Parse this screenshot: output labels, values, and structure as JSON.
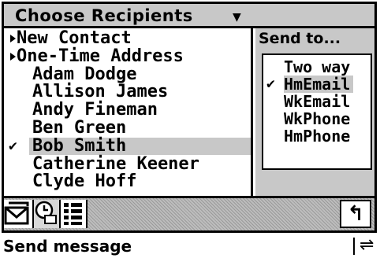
{
  "title": "Choose Recipients",
  "contacts": [
    {
      "label": "New Contact",
      "type": "action"
    },
    {
      "label": "One-Time Address",
      "type": "action"
    },
    {
      "label": "Adam Dodge",
      "type": "contact"
    },
    {
      "label": "Allison James",
      "type": "contact"
    },
    {
      "label": "Andy Fineman",
      "type": "contact"
    },
    {
      "label": "Ben Green",
      "type": "contact"
    },
    {
      "label": "Bob Smith",
      "type": "contact",
      "selected": true
    },
    {
      "label": "Catherine Keener",
      "type": "contact"
    },
    {
      "label": "Clyde Hoff",
      "type": "contact"
    }
  ],
  "send_to": {
    "label": "Send to...",
    "options": [
      {
        "label": "Two way",
        "checked": false
      },
      {
        "label": "HmEmail",
        "checked": true
      },
      {
        "label": "WkEmail",
        "checked": false
      },
      {
        "label": "WkPhone",
        "checked": false
      },
      {
        "label": "HmPhone",
        "checked": false
      }
    ]
  },
  "toolbar": {
    "buttons": [
      "mail-app-icon",
      "clock-app-icon",
      "list-view-icon"
    ],
    "back_glyph": "↰"
  },
  "status": {
    "text": "Send message",
    "icon_glyph": "⇌"
  },
  "colors": {
    "highlight": "#c8c8c8",
    "border": "#000000"
  }
}
